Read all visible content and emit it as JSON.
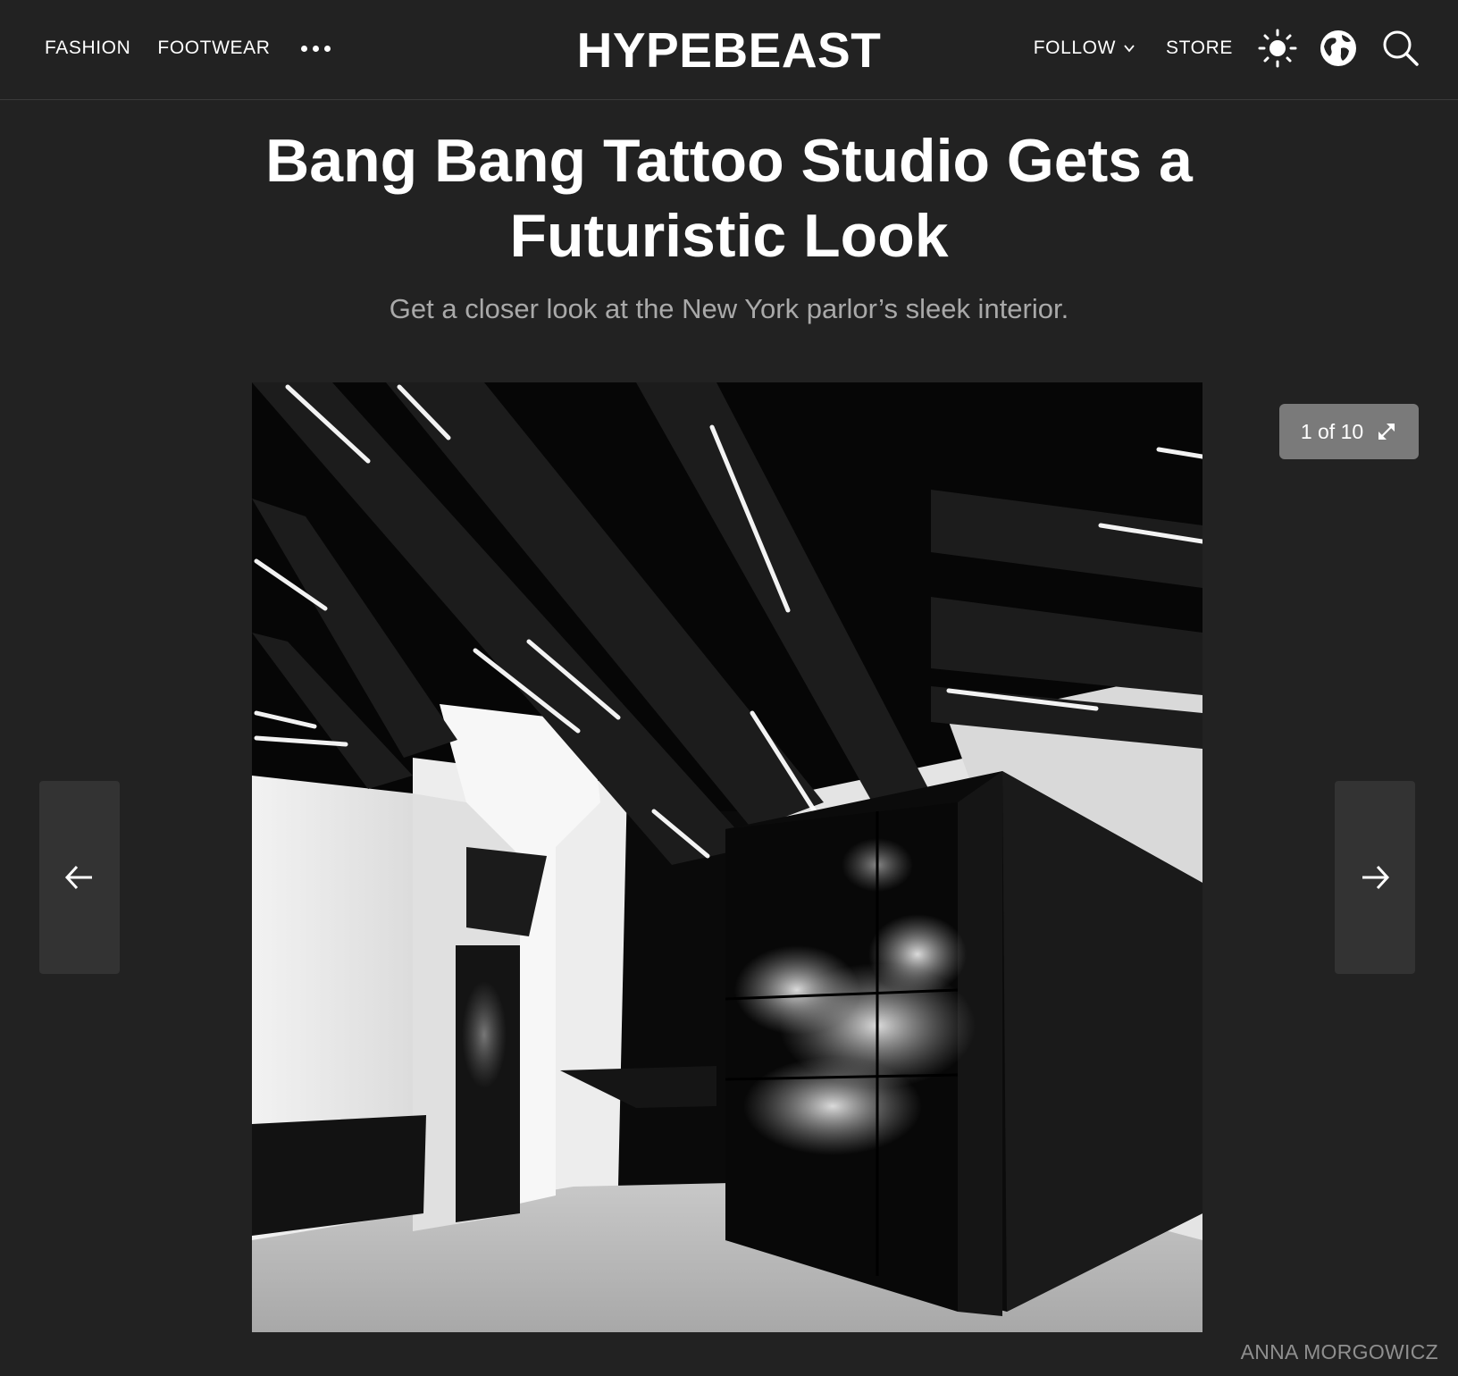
{
  "header": {
    "nav_left": [
      "FASHION",
      "FOOTWEAR"
    ],
    "more_icon": "more-dots-icon",
    "logo": "HYPEBEAST",
    "follow_label": "FOLLOW",
    "store_label": "STORE",
    "icons": [
      "sun-icon",
      "globe-icon",
      "search-icon"
    ]
  },
  "article": {
    "title": "Bang Bang Tattoo Studio Gets a Futuristic Look",
    "dek": "Get a closer look at the New York parlor’s sleek interior."
  },
  "gallery": {
    "counter": "1 of 10",
    "expand_icon": "expand-icon",
    "prev_icon": "arrow-left-icon",
    "next_icon": "arrow-right-icon",
    "photo_credit": "ANNA MORGOWICZ"
  },
  "colors": {
    "background": "#222222",
    "header_border": "#3a3a3a",
    "dek_text": "#a9a9a9",
    "counter_bg": "#7a7a7a",
    "arrow_bg": "#333333",
    "credit_text": "#8f8f8f"
  }
}
